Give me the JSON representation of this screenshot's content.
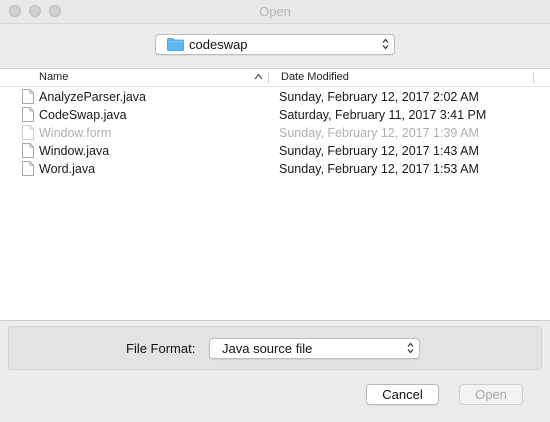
{
  "window": {
    "title": "Open"
  },
  "location": {
    "folder_name": "codeswap"
  },
  "columns": {
    "name": "Name",
    "date_modified": "Date Modified"
  },
  "files": [
    {
      "name": "AnalyzeParser.java",
      "modified": "Sunday, February 12, 2017 2:02 AM",
      "enabled": true
    },
    {
      "name": "CodeSwap.java",
      "modified": "Saturday, February 11, 2017 3:41 PM",
      "enabled": true
    },
    {
      "name": "Window.form",
      "modified": "Sunday, February 12, 2017 1:39 AM",
      "enabled": false
    },
    {
      "name": "Window.java",
      "modified": "Sunday, February 12, 2017 1:43 AM",
      "enabled": true
    },
    {
      "name": "Word.java",
      "modified": "Sunday, February 12, 2017 1:53 AM",
      "enabled": true
    }
  ],
  "file_format": {
    "label": "File Format:",
    "selected": "Java source file"
  },
  "buttons": {
    "cancel": "Cancel",
    "open": "Open"
  },
  "colors": {
    "folder_blue": "#5fb5f0",
    "disabled_text": "#b0b0b0"
  }
}
